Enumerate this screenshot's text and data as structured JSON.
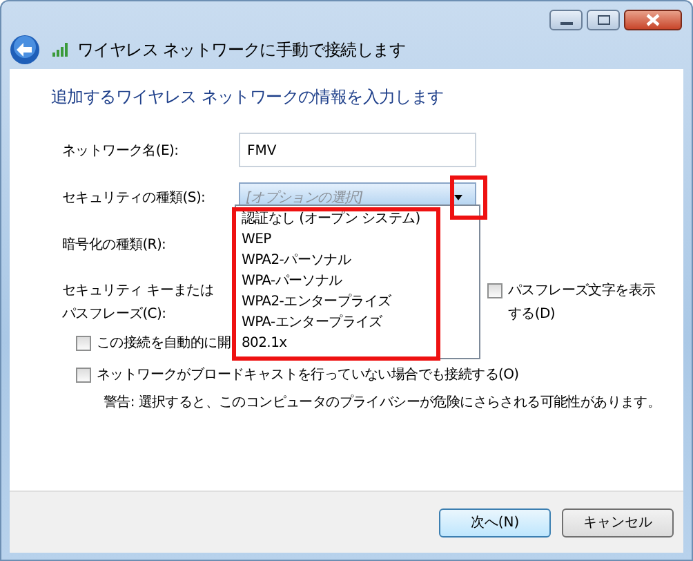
{
  "window": {
    "title": "ワイヤレス ネットワークに手動で接続します"
  },
  "heading": "追加するワイヤレス ネットワークの情報を入力します",
  "network_name": {
    "label": "ネットワーク名(E):",
    "value": "FMV"
  },
  "security_type": {
    "label": "セキュリティの種類(S):",
    "value": "[オプションの選択]",
    "expanded": true,
    "arrow_highlighted": true,
    "list_highlighted": true,
    "options": [
      "認証なし (オープン システム)",
      "WEP",
      "WPA2-パーソナル",
      "WPA-パーソナル",
      "WPA2-エンタープライズ",
      "WPA-エンタープライズ",
      "802.1x"
    ]
  },
  "encryption_type": {
    "label": "暗号化の種類(R):"
  },
  "security_key": {
    "label_lines": [
      "セキュリティ キーまたは",
      "パスフレーズ(C):"
    ]
  },
  "show_characters": {
    "label": "パスフレーズ文字を表示する(D)",
    "checked": false
  },
  "auto_start": {
    "label": "この接続を自動的に開",
    "checked": false
  },
  "connect_hidden": {
    "label": "ネットワークがブロードキャストを行っていない場合でも接続する(O)",
    "checked": false
  },
  "warning": "警告: 選択すると、このコンピュータのプライバシーが危険にさらされる可能性があります。",
  "buttons": [
    {
      "label": "次へ(N)",
      "default": true
    },
    {
      "label": "キャンセル",
      "default": false
    }
  ]
}
